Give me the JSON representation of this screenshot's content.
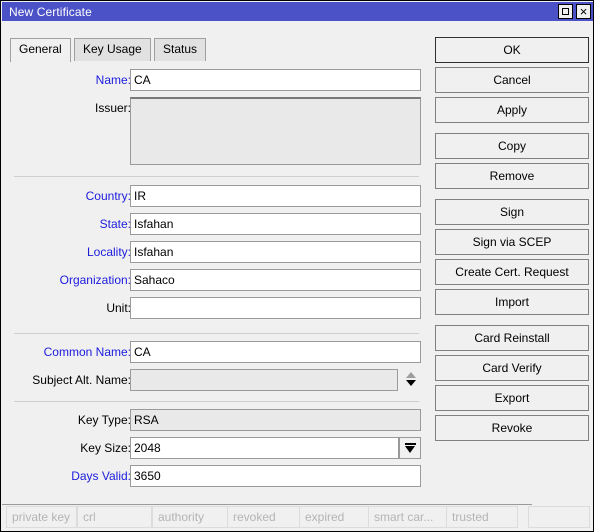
{
  "window": {
    "title": "New Certificate",
    "titlebar_color": "#4b51c6",
    "buttons": {
      "restore": "restore-box",
      "close": "×"
    }
  },
  "tabs": [
    {
      "label": "General",
      "active": true
    },
    {
      "label": "Key Usage",
      "active": false
    },
    {
      "label": "Status",
      "active": false
    }
  ],
  "form": {
    "fields": [
      {
        "label": "Name:",
        "value": "CA",
        "label_color": "blue",
        "state": "editable"
      },
      {
        "label": "Issuer:",
        "value": "",
        "label_color": "black",
        "state": "readonly-multiline"
      },
      {
        "label": "Country:",
        "value": "IR",
        "label_color": "blue",
        "state": "editable"
      },
      {
        "label": "State:",
        "value": "Isfahan",
        "label_color": "blue",
        "state": "editable"
      },
      {
        "label": "Locality:",
        "value": "Isfahan",
        "label_color": "blue",
        "state": "editable"
      },
      {
        "label": "Organization:",
        "value": "Sahaco",
        "label_color": "blue",
        "state": "editable"
      },
      {
        "label": "Unit:",
        "value": "",
        "label_color": "black",
        "state": "editable"
      },
      {
        "label": "Common Name:",
        "value": "CA",
        "label_color": "blue",
        "state": "editable"
      },
      {
        "label": "Subject Alt. Name:",
        "value": "",
        "label_color": "black",
        "state": "disabled-spinner"
      },
      {
        "label": "Key Type:",
        "value": "RSA",
        "label_color": "black",
        "state": "disabled"
      },
      {
        "label": "Key Size:",
        "value": "2048",
        "label_color": "black",
        "state": "combo"
      },
      {
        "label": "Days Valid:",
        "value": "3650",
        "label_color": "blue",
        "state": "editable"
      }
    ]
  },
  "actions": [
    {
      "label": "OK",
      "default": true
    },
    {
      "label": "Cancel",
      "default": false
    },
    {
      "label": "Apply",
      "default": false
    },
    {
      "label": "Copy",
      "default": false
    },
    {
      "label": "Remove",
      "default": false
    },
    {
      "label": "Sign",
      "default": false
    },
    {
      "label": "Sign via SCEP",
      "default": false
    },
    {
      "label": "Create Cert. Request",
      "default": false
    },
    {
      "label": "Import",
      "default": false
    },
    {
      "label": "Card Reinstall",
      "default": false
    },
    {
      "label": "Card Verify",
      "default": false
    },
    {
      "label": "Export",
      "default": false
    },
    {
      "label": "Revoke",
      "default": false
    }
  ],
  "status_flags": [
    {
      "label": "private key"
    },
    {
      "label": "crl"
    },
    {
      "label": "authority"
    },
    {
      "label": "revoked"
    },
    {
      "label": "expired"
    },
    {
      "label": "smart car..."
    },
    {
      "label": "trusted"
    },
    {
      "label": ""
    }
  ]
}
